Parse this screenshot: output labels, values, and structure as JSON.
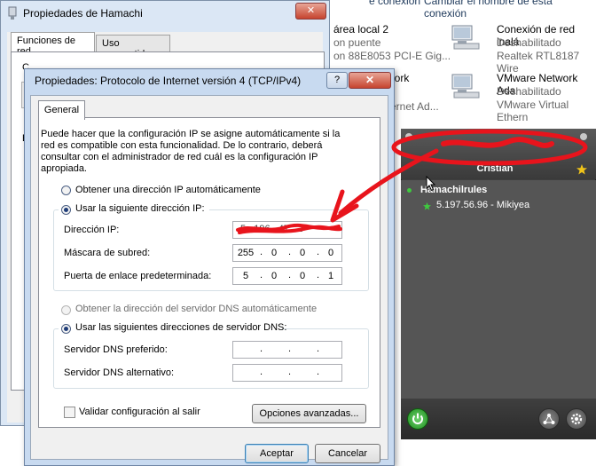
{
  "background_window": {
    "top_links": [
      "... área local 2 (cut)",
      "Cambiar el nombre de esta conexión"
    ],
    "top_link_visible": [
      "e conexión",
      "Cambiar el nombre de esta conexión"
    ],
    "connections": [
      {
        "title": "área local 2",
        "status": "on puente",
        "device": "on 88E8053 PCI-E Gig..."
      },
      {
        "title": "Conexión de red inalá",
        "status": "Deshabilitado",
        "device": "Realtek RTL8187 Wire"
      },
      {
        "title": "work",
        "status": "",
        "device": "ernet Ad..."
      },
      {
        "title": "VMware Network Ada",
        "status": "Deshabilitado",
        "device": "VMware Virtual Ethern"
      }
    ]
  },
  "hamachi_dialog": {
    "title": "Propiedades de Hamachi",
    "close_label": "✕",
    "tabs": [
      {
        "label": "Funciones de red"
      },
      {
        "label": "Uso compartido"
      }
    ],
    "partial_labels": [
      "C",
      "B"
    ]
  },
  "ipv4_dialog": {
    "title": "Propiedades: Protocolo de Internet versión 4 (TCP/IPv4)",
    "help_label": "?",
    "close_label": "✕",
    "tab_label": "General",
    "intro": "Puede hacer que la configuración IP se asigne automáticamente si la red es compatible con esta funcionalidad. De lo contrario, deberá consultar con el administrador de red cuál es la configuración IP apropiada.",
    "radio_auto_ip": "Obtener una dirección IP automáticamente",
    "radio_static_ip": "Usar la siguiente dirección IP:",
    "ip_label": "Dirección IP:",
    "ip_value": "5 . 196 . 47 . 2",
    "mask_label": "Máscara de subred:",
    "mask_segments": [
      "255",
      "0",
      "0",
      "0"
    ],
    "gateway_label": "Puerta de enlace predeterminada:",
    "gateway_segments": [
      "5",
      "0",
      "0",
      "1"
    ],
    "radio_auto_dns": "Obtener la dirección del servidor DNS automáticamente",
    "radio_static_dns": "Usar las siguientes direcciones de servidor DNS:",
    "dns_pref_label": "Servidor DNS preferido:",
    "dns_alt_label": "Servidor DNS alternativo:",
    "empty_dot": ".",
    "validate_label": "Validar configuración al salir",
    "advanced_label": "Opciones avanzadas...",
    "ok_label": "Aceptar",
    "cancel_label": "Cancelar"
  },
  "hamachi_client": {
    "user": "Cristian",
    "network": "Hamachilrules",
    "peer": "5.197.56.96 - Mikiyea"
  },
  "colors": {
    "annotation_red": "#e8141c",
    "hamachi_dark": "#3e3e3e",
    "online_green": "#3fc93f",
    "window_frame": "#c8daf0"
  }
}
